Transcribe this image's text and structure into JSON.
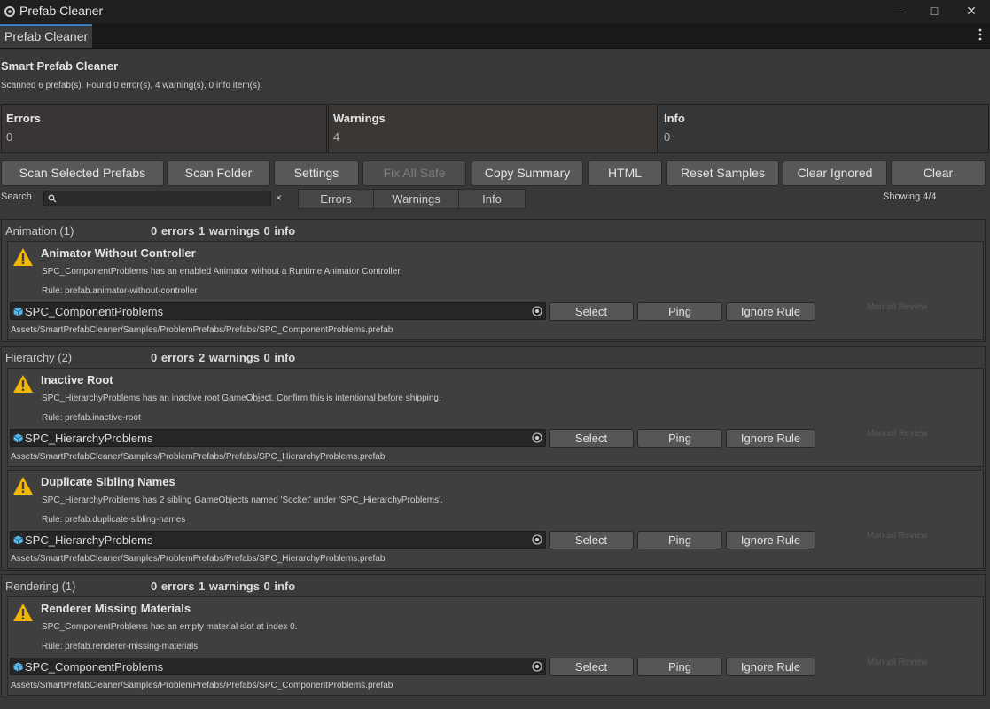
{
  "window": {
    "title": "Prefab Cleaner",
    "minimize": "—",
    "maximize": "□",
    "close": "✕"
  },
  "tab": {
    "label": "Prefab Cleaner"
  },
  "header": {
    "heading": "Smart Prefab Cleaner",
    "summary": "Scanned 6 prefab(s). Found 0 error(s), 4 warning(s), 0 info item(s)."
  },
  "cards": {
    "errors": {
      "label": "Errors",
      "value": "0"
    },
    "warnings": {
      "label": "Warnings",
      "value": "4"
    },
    "info": {
      "label": "Info",
      "value": "0"
    }
  },
  "toolbar": {
    "scan_selected": "Scan Selected Prefabs",
    "scan_folder": "Scan Folder",
    "settings": "Settings",
    "fix_all_safe": "Fix All Safe",
    "copy_summary": "Copy Summary",
    "html": "HTML",
    "reset_samples": "Reset Samples",
    "clear_ignored": "Clear Ignored",
    "clear": "Clear"
  },
  "filter": {
    "search_label": "Search",
    "search_value": "",
    "clear_x": "×",
    "tabs": [
      "Errors",
      "Warnings",
      "Info"
    ],
    "showing": "Showing 4/4"
  },
  "colors": {
    "warning_icon": "#f2b705",
    "cube_icon": "#5ab7e8",
    "tab_accent": "#3a79bb",
    "errors_card": "#3a3535",
    "warnings_card": "#3a3734",
    "info_card": "#343638"
  },
  "groups": [
    {
      "name": "Animation (1)",
      "stats": "0 errors 1 warnings 0 info",
      "issues": [
        {
          "title": "Animator Without Controller",
          "message": "SPC_ComponentProblems has an enabled Animator without a Runtime Animator Controller.",
          "rule": "Rule: prefab.animator-without-controller",
          "object": "SPC_ComponentProblems",
          "select": "Select",
          "ping": "Ping",
          "ignore": "Ignore Rule",
          "status": "Manual Review",
          "path": "Assets/SmartPrefabCleaner/Samples/ProblemPrefabs/Prefabs/SPC_ComponentProblems.prefab"
        }
      ]
    },
    {
      "name": "Hierarchy (2)",
      "stats": "0 errors 2 warnings 0 info",
      "issues": [
        {
          "title": "Inactive Root",
          "message": "SPC_HierarchyProblems has an inactive root GameObject. Confirm this is intentional before shipping.",
          "rule": "Rule: prefab.inactive-root",
          "object": "SPC_HierarchyProblems",
          "select": "Select",
          "ping": "Ping",
          "ignore": "Ignore Rule",
          "status": "Manual Review",
          "path": "Assets/SmartPrefabCleaner/Samples/ProblemPrefabs/Prefabs/SPC_HierarchyProblems.prefab"
        },
        {
          "title": "Duplicate Sibling Names",
          "message": "SPC_HierarchyProblems has 2 sibling GameObjects named 'Socket' under 'SPC_HierarchyProblems'.",
          "rule": "Rule: prefab.duplicate-sibling-names",
          "object": "SPC_HierarchyProblems",
          "select": "Select",
          "ping": "Ping",
          "ignore": "Ignore Rule",
          "status": "Manual Review",
          "path": "Assets/SmartPrefabCleaner/Samples/ProblemPrefabs/Prefabs/SPC_HierarchyProblems.prefab"
        }
      ]
    },
    {
      "name": "Rendering (1)",
      "stats": "0 errors 1 warnings 0 info",
      "issues": [
        {
          "title": "Renderer Missing Materials",
          "message": "SPC_ComponentProblems has an empty material slot at index 0.",
          "rule": "Rule: prefab.renderer-missing-materials",
          "object": "SPC_ComponentProblems",
          "select": "Select",
          "ping": "Ping",
          "ignore": "Ignore Rule",
          "status": "Manual Review",
          "path": "Assets/SmartPrefabCleaner/Samples/ProblemPrefabs/Prefabs/SPC_ComponentProblems.prefab"
        }
      ]
    }
  ]
}
